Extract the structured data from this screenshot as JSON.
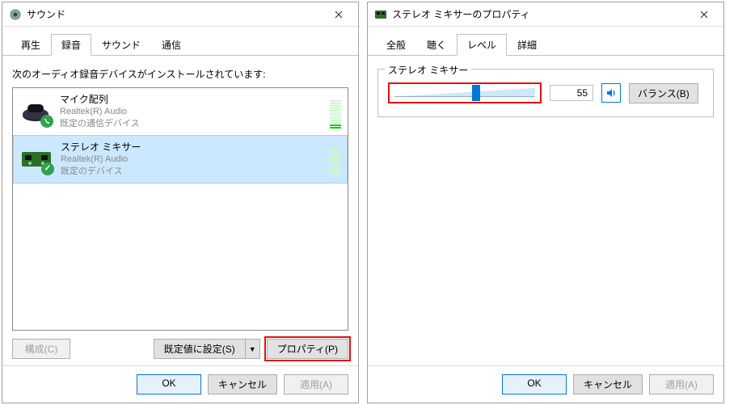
{
  "left": {
    "title": "サウンド",
    "tabs": {
      "playback": "再生",
      "recording": "録音",
      "sounds": "サウンド",
      "communications": "通信"
    },
    "instruction": "次のオーディオ録音デバイスがインストールされています:",
    "devices": [
      {
        "name": "マイク配列",
        "driver": "Realtek(R) Audio",
        "status": "既定の通信デバイス"
      },
      {
        "name": "ステレオ ミキサー",
        "driver": "Realtek(R) Audio",
        "status": "既定のデバイス"
      }
    ],
    "buttons": {
      "configure": "構成(C)",
      "setDefault": "既定値に設定(S)",
      "properties": "プロパティ(P)"
    },
    "bottom": {
      "ok": "OK",
      "cancel": "キャンセル",
      "apply": "適用(A)"
    }
  },
  "right": {
    "title": "ステレオ ミキサーのプロパティ",
    "tabs": {
      "general": "全般",
      "listen": "聴く",
      "levels": "レベル",
      "advanced": "詳細"
    },
    "group": "ステレオ ミキサー",
    "level_value": "55",
    "balance": "バランス(B)",
    "bottom": {
      "ok": "OK",
      "cancel": "キャンセル",
      "apply": "適用(A)"
    }
  }
}
